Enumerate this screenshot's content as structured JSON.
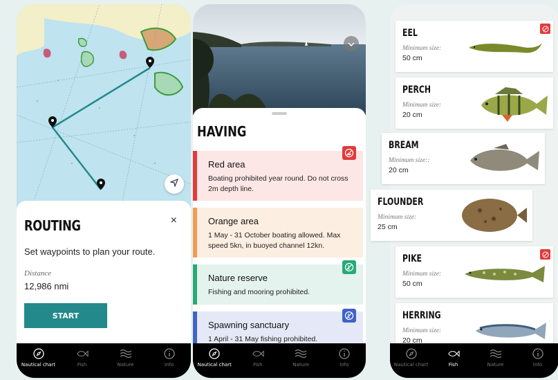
{
  "colors": {
    "accent": "#23898a",
    "red": "#e23b3b",
    "orange": "#f29b53",
    "green": "#28a979",
    "blue": "#3f63c8"
  },
  "tabs": [
    {
      "label": "Nautical chart",
      "icon": "compass-icon"
    },
    {
      "label": "Fish",
      "icon": "fish-icon"
    },
    {
      "label": "Nature",
      "icon": "waves-icon"
    },
    {
      "label": "Info",
      "icon": "info-icon"
    }
  ],
  "routing": {
    "title": "ROUTING",
    "close": "×",
    "subtitle": "Set waypoints to plan your route.",
    "distance_label": "Distance",
    "distance_value": "12,986 nmi",
    "start_label": "START"
  },
  "areas": {
    "title": "HAVING",
    "cards": [
      {
        "title": "Red area",
        "desc": "Boating prohibited year round. Do not cross 2m depth line.",
        "color": "#e23b3b",
        "bg": "#fde7e6",
        "icon": "no-boat-icon"
      },
      {
        "title": "Orange area",
        "desc": "1 May - 31 October boating allowed. Max speed 5kn, in buoyed channel 12kn.",
        "color": "#f29b53",
        "bg": "#fdeee2",
        "icon": ""
      },
      {
        "title": "Nature reserve",
        "desc": "Fishing and mooring prohibited.",
        "color": "#28a979",
        "bg": "#e4f3ee",
        "icon": "no-fishing-icon"
      },
      {
        "title": "Spawning sanctuary",
        "desc": "1 April - 31 May fishing prohibited.",
        "color": "#3f63c8",
        "bg": "#e5e9f7",
        "icon": "no-fishing-icon"
      }
    ]
  },
  "fish": {
    "items": [
      {
        "name": "EEL",
        "label": "Minimum size:",
        "size": "50 cm",
        "badge": true
      },
      {
        "name": "PERCH",
        "label": "Minimum size:",
        "size": "20 cm",
        "badge": false
      },
      {
        "name": "BREAM",
        "label": "Minimum size::",
        "size": "20 cm",
        "badge": false
      },
      {
        "name": "FLOUNDER",
        "label": "Minimum size:",
        "size": "25 cm",
        "badge": false
      },
      {
        "name": "PIKE",
        "label": "Minimum size:",
        "size": "50 cm",
        "badge": true
      },
      {
        "name": "HERRING",
        "label": "Minimum size:",
        "size": "20 cm",
        "badge": false
      }
    ]
  }
}
